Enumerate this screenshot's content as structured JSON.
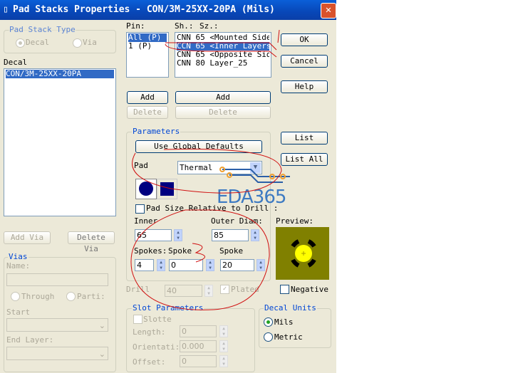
{
  "window": {
    "title": "Pad Stacks Properties - CON/3M-25XX-20PA (Mils)",
    "close": "✕"
  },
  "pad_stack_type": {
    "label": "Pad Stack Type",
    "decal": "Decal",
    "via": "Via",
    "selected": "Decal"
  },
  "decal": {
    "label": "Decal",
    "items": [
      "CON/3M-25XX-20PA"
    ]
  },
  "pin": {
    "label": "Pin:",
    "items": [
      "All (P)",
      "1 (P)"
    ],
    "selected": "All (P)",
    "add": "Add",
    "delete": "Delete"
  },
  "shape": {
    "label_sh": "Sh.:",
    "label_sz": "Sz.:",
    "items": [
      "CNN 65 <Mounted Side>",
      "CCN 65 <Inner Layers>",
      "CNN 65 <Opposite Side>",
      "CNN 80 Layer_25"
    ],
    "selected": "CCN 65 <Inner Layers>",
    "add": "Add",
    "delete": "Delete"
  },
  "buttons": {
    "ok": "OK",
    "cancel": "Cancel",
    "help": "Help",
    "list": "List",
    "list_all": "List All",
    "add_via": "Add Via",
    "delete_via": "Delete Via"
  },
  "parameters": {
    "label": "Parameters",
    "use_global": "Use Global Defaults",
    "pad_label": "Pad",
    "pad_type": "Thermal",
    "pad_size_relative": "Pad Size Relative to Drill :",
    "inner_label": "Inner",
    "inner": "65",
    "outer_label": "Outer Diam:",
    "outer": "85",
    "spokes_label": "Spokes:",
    "spokes": "4",
    "spoke_angle_label": "Spoke",
    "spoke_angle": "0",
    "spoke_width_label": "Spoke",
    "spoke_width": "20"
  },
  "preview": {
    "label": "Preview:",
    "negative": "Negative",
    "bg_color": "#808000",
    "pad_color": "#ffff00"
  },
  "drill": {
    "label": "Drill",
    "value": "40",
    "plated": "Plated"
  },
  "vias": {
    "label": "Vias",
    "name_label": "Name:",
    "through": "Through",
    "partial": "Parti:",
    "start": "Start",
    "end_layer": "End Layer:"
  },
  "slot": {
    "label": "Slot Parameters",
    "slotted": "Slotte",
    "length_label": "Length:",
    "length": "0",
    "orientation_label": "Orientati:",
    "orientation": "0.000",
    "offset_label": "Offset:",
    "offset": "0"
  },
  "units": {
    "label": "Decal Units",
    "mils": "Mils",
    "metric": "Metric",
    "selected": "Mils"
  },
  "watermark": "EDA365"
}
